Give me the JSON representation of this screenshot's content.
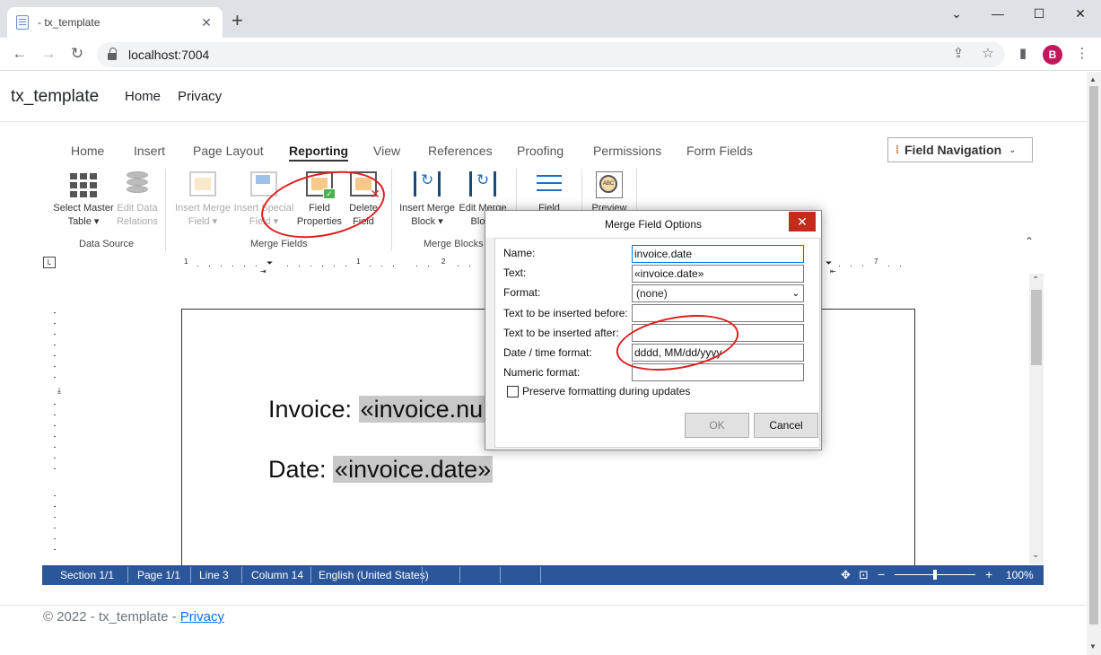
{
  "browser": {
    "tab_title": "- tx_template",
    "url": "localhost:7004",
    "avatar_letter": "B"
  },
  "site": {
    "brand": "tx_template",
    "nav": [
      "Home",
      "Privacy"
    ],
    "footer_text": "© 2022 - tx_template - ",
    "footer_link": "Privacy"
  },
  "ribbon": {
    "tabs": [
      "Home",
      "Insert",
      "Page Layout",
      "Reporting",
      "View",
      "References",
      "Proofing",
      "Permissions",
      "Form Fields"
    ],
    "active_tab": "Reporting",
    "field_navigation": "Field Navigation",
    "buttons": {
      "select_master_table": [
        "Select Master",
        "Table ▾"
      ],
      "edit_data_relations": [
        "Edit Data",
        "Relations"
      ],
      "insert_merge_field": [
        "Insert Merge",
        "Field ▾"
      ],
      "insert_special_field": [
        "Insert Special",
        "Field ▾"
      ],
      "field_properties": [
        "Field",
        "Properties"
      ],
      "delete_field": [
        "Delete",
        "Field"
      ],
      "insert_merge_block": [
        "Insert Merge",
        "Block ▾"
      ],
      "edit_merge_block": [
        "Edit Merge",
        "Block"
      ],
      "field_mappings": [
        "Field",
        ""
      ],
      "preview": [
        "Preview",
        ""
      ]
    },
    "groups": [
      "Data Source",
      "Merge Fields",
      "Merge Blocks"
    ]
  },
  "document": {
    "line1_label": "Invoice: ",
    "line1_field": "«invoice.nu",
    "line2_label": "Date: ",
    "line2_field": "«invoice.date»",
    "ruler_marks": [
      "1",
      "1",
      "2",
      "7"
    ]
  },
  "statusbar": {
    "section": "Section 1/1",
    "page": "Page 1/1",
    "line": "Line 3",
    "column": "Column 14",
    "language": "English (United States)",
    "zoom": "100%",
    "zoom_level_percent": 100
  },
  "dialog": {
    "title": "Merge Field Options",
    "labels": {
      "name": "Name:",
      "text": "Text:",
      "format": "Format:",
      "before": "Text to be inserted before:",
      "after": "Text to be inserted after:",
      "datetime": "Date / time format:",
      "numeric": "Numeric format:"
    },
    "values": {
      "name": "invoice.date",
      "text": "«invoice.date»",
      "format": "(none)",
      "before": "",
      "after": "",
      "datetime": "dddd, MM/dd/yyyy",
      "numeric": ""
    },
    "preserve_formatting": "Preserve formatting during updates",
    "ok": "OK",
    "cancel": "Cancel"
  },
  "colors": {
    "statusbar": "#2b579a",
    "annotation": "#e01e1e",
    "close_button": "#c42b1c"
  }
}
